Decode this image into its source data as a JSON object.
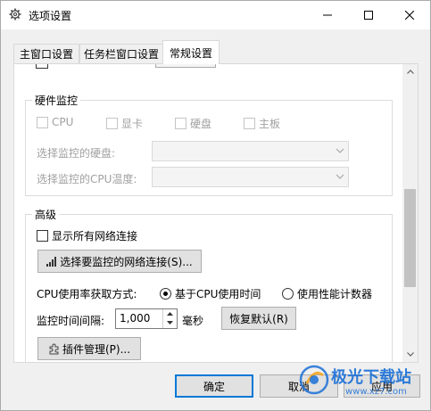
{
  "window": {
    "title": "选项设置",
    "icon": "gear-icon",
    "controls": [
      "minimize-icon",
      "maximize-icon",
      "close-icon"
    ]
  },
  "tabs": [
    {
      "label": "主窗口设置",
      "active": false
    },
    {
      "label": "任务栏窗口设置",
      "active": false
    },
    {
      "label": "常规设置",
      "active": true
    }
  ],
  "hardware": {
    "title": "硬件监控",
    "checkboxes": [
      {
        "label": "CPU",
        "checked": false,
        "enabled": false
      },
      {
        "label": "显卡",
        "checked": false,
        "enabled": false
      },
      {
        "label": "硬盘",
        "checked": false,
        "enabled": false
      },
      {
        "label": "主板",
        "checked": false,
        "enabled": false
      }
    ],
    "disk_label": "选择监控的硬盘:",
    "cpu_temp_label": "选择监控的CPU温度:",
    "disk_value": "",
    "cpu_temp_value": ""
  },
  "advanced": {
    "title": "高级",
    "show_all_connections_label": "显示所有网络连接",
    "select_connection_button": "选择要监控的网络连接(S)...",
    "cpu_method_label": "CPU使用率获取方式:",
    "cpu_method_options": [
      {
        "label": "基于CPU使用时间",
        "selected": true
      },
      {
        "label": "使用性能计数器",
        "selected": false
      }
    ],
    "interval_label": "监控时间间隔:",
    "interval_value": "1,000",
    "interval_unit": "毫秒",
    "reset_button": "恢复默认(R)",
    "plugin_button": "插件管理(P)..."
  },
  "footer": {
    "ok": "确定",
    "cancel": "取消",
    "apply": "应用"
  },
  "watermark": {
    "text": "极光下载站",
    "url": "www.xz7.com"
  },
  "colors": {
    "accent": "#0078d7",
    "disabled_text": "#a0a0a0",
    "watermark_blue": "#1a6fd6"
  }
}
